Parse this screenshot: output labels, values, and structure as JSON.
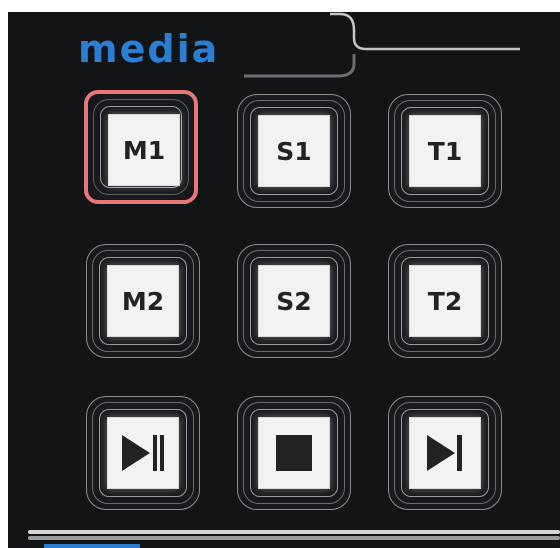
{
  "section": {
    "title": "media"
  },
  "buttons": [
    {
      "label": "M1",
      "selected": true
    },
    {
      "label": "S1"
    },
    {
      "label": "T1"
    },
    {
      "label": "M2"
    },
    {
      "label": "S2"
    },
    {
      "label": "T2"
    },
    {
      "icon": "play-pause-icon"
    },
    {
      "icon": "stop-icon"
    },
    {
      "icon": "skip-next-icon"
    }
  ],
  "colors": {
    "title": "#2a7fd4",
    "selected_outline": "#e87878",
    "panel_background": "#131416",
    "button_face": "#f2f2f2"
  }
}
